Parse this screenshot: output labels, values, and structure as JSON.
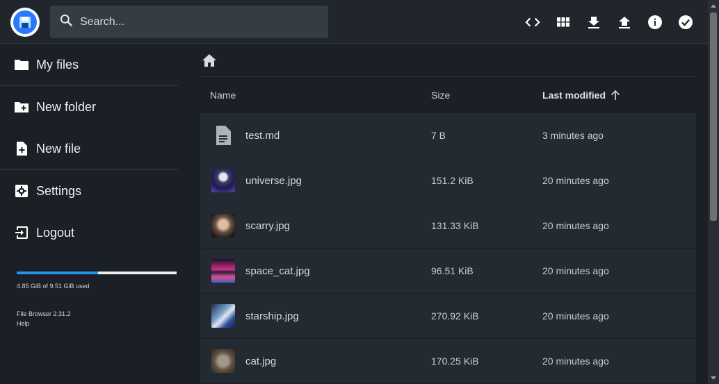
{
  "header": {
    "search_placeholder": "Search...",
    "actions": [
      "code-icon",
      "grid-view-icon",
      "download-icon",
      "upload-icon",
      "info-icon",
      "select-check-icon"
    ]
  },
  "sidebar": {
    "items": [
      {
        "label": "My files",
        "icon": "folder-icon"
      },
      {
        "label": "New folder",
        "icon": "new-folder-icon"
      },
      {
        "label": "New file",
        "icon": "new-file-icon"
      },
      {
        "label": "Settings",
        "icon": "settings-icon"
      },
      {
        "label": "Logout",
        "icon": "logout-icon"
      }
    ],
    "usage": {
      "text": "4.85 GiB of 9.51 GiB used",
      "fraction": 0.51
    },
    "version": "File Browser 2.31.2",
    "help": "Help"
  },
  "list": {
    "headers": {
      "name": "Name",
      "size": "Size",
      "modified": "Last modified"
    },
    "rows": [
      {
        "name": "test.md",
        "size": "7 B",
        "modified": "3 minutes ago"
      },
      {
        "name": "universe.jpg",
        "size": "151.2 KiB",
        "modified": "20 minutes ago"
      },
      {
        "name": "scarry.jpg",
        "size": "131.33 KiB",
        "modified": "20 minutes ago"
      },
      {
        "name": "space_cat.jpg",
        "size": "96.51 KiB",
        "modified": "20 minutes ago"
      },
      {
        "name": "starship.jpg",
        "size": "270.92 KiB",
        "modified": "20 minutes ago"
      },
      {
        "name": "cat.jpg",
        "size": "170.25 KiB",
        "modified": "20 minutes ago"
      }
    ]
  },
  "colors": {
    "accent": "#2196f3",
    "background": "#1b2026",
    "header": "#21262d",
    "row": "#242a31"
  }
}
